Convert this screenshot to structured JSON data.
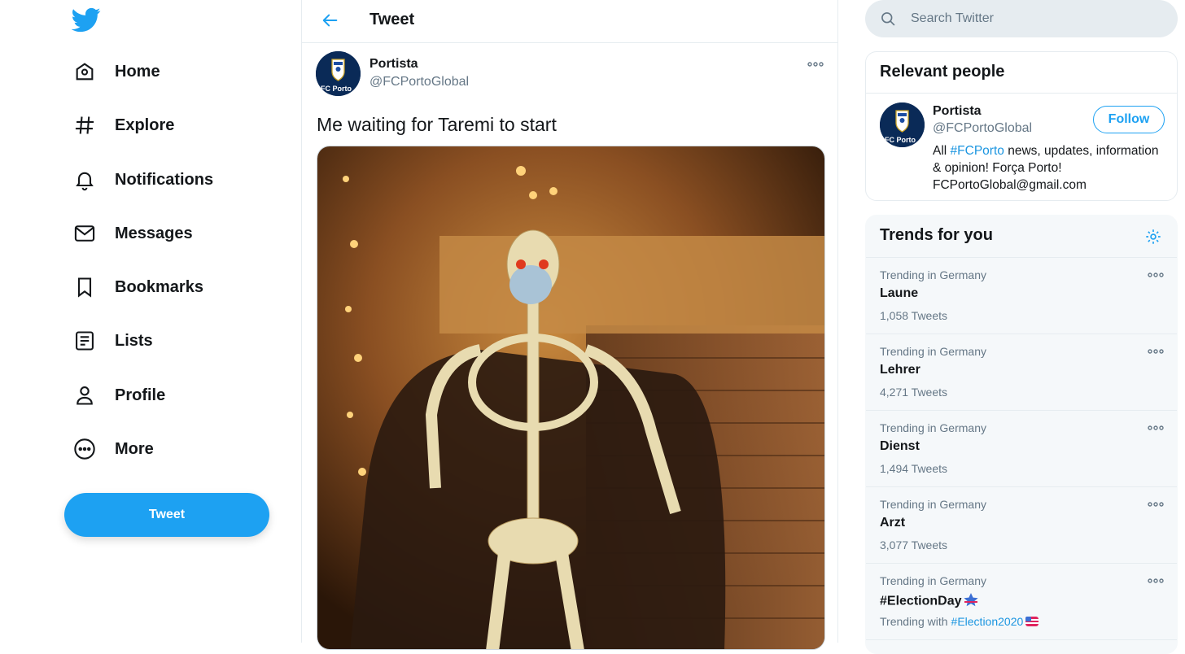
{
  "brand": {
    "accent": "#1da1f2",
    "text_primary": "#14171a",
    "text_secondary": "#657786"
  },
  "nav": {
    "items": [
      {
        "label": "Home",
        "icon": "home-icon"
      },
      {
        "label": "Explore",
        "icon": "hashtag-icon"
      },
      {
        "label": "Notifications",
        "icon": "bell-icon"
      },
      {
        "label": "Messages",
        "icon": "envelope-icon"
      },
      {
        "label": "Bookmarks",
        "icon": "bookmark-icon"
      },
      {
        "label": "Lists",
        "icon": "list-icon"
      },
      {
        "label": "Profile",
        "icon": "person-icon"
      },
      {
        "label": "More",
        "icon": "more-circle-icon"
      }
    ],
    "tweet_button": "Tweet"
  },
  "header": {
    "title": "Tweet"
  },
  "tweet": {
    "author_name": "Portista",
    "author_handle": "@FCPortoGlobal",
    "avatar_text": "FC Porto",
    "text": "Me waiting for Taremi to start"
  },
  "search": {
    "placeholder": "Search Twitter"
  },
  "relevant_people": {
    "title": "Relevant people",
    "person": {
      "name": "Portista",
      "handle": "@FCPortoGlobal",
      "follow_label": "Follow",
      "bio_prefix": "All ",
      "bio_tag": "#FCPorto",
      "bio_rest": " news, updates, information & opinion! Força Porto! FCPortoGlobal@gmail.com"
    }
  },
  "trends": {
    "title": "Trends for you",
    "items": [
      {
        "context": "Trending in Germany",
        "name": "Laune",
        "count": "1,058 Tweets"
      },
      {
        "context": "Trending in Germany",
        "name": "Lehrer",
        "count": "4,271 Tweets"
      },
      {
        "context": "Trending in Germany",
        "name": "Dienst",
        "count": "1,494 Tweets"
      },
      {
        "context": "Trending in Germany",
        "name": "Arzt",
        "count": "3,077 Tweets"
      },
      {
        "context": "Trending in Germany",
        "name": "#ElectionDay",
        "count_prefix": "Trending with",
        "count_tag": "#Election2020"
      }
    ]
  }
}
